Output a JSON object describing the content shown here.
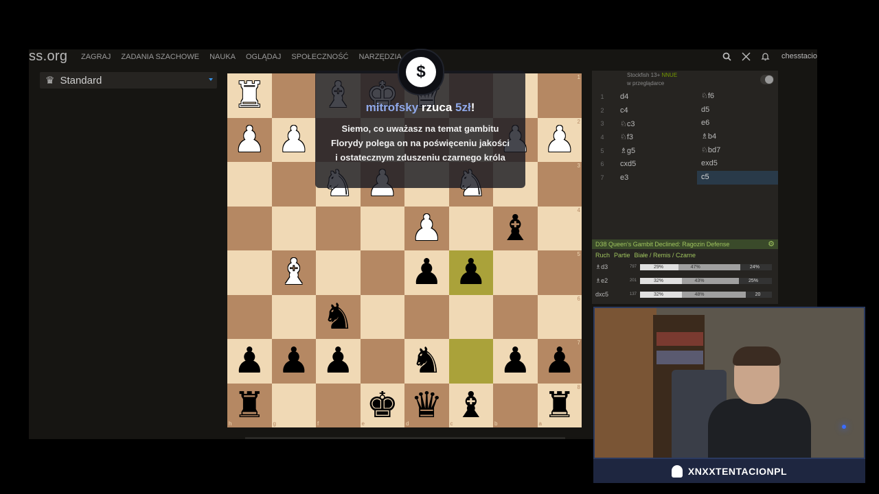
{
  "topbar": {
    "logo": "ss.org",
    "nav": [
      "ZAGRAJ",
      "ZADANIA SZACHOWE",
      "NAUKA",
      "OGLĄDAJ",
      "SPOŁECZNOŚĆ",
      "NARZĘDZIA"
    ],
    "username": "chesstacio"
  },
  "variant": {
    "label": "Standard",
    "icon": "crown-icon"
  },
  "board": {
    "rank_labels": [
      "1",
      "2",
      "3",
      "4",
      "5",
      "6",
      "7",
      "8"
    ],
    "file_labels": [
      "h",
      "g",
      "f",
      "e",
      "d",
      "c",
      "b",
      "a"
    ],
    "ranks": [
      [
        "♜",
        "",
        "♝",
        "♚",
        "♛",
        "",
        "",
        ""
      ],
      [
        "♟",
        "♟",
        "",
        "",
        "",
        "",
        "♟",
        "♟"
      ],
      [
        "",
        "",
        "♞",
        "♟",
        "",
        "♞",
        "",
        ""
      ],
      [
        "",
        "",
        "",
        "",
        "♟",
        "",
        "♝",
        ""
      ],
      [
        "",
        "♝",
        "",
        "",
        "♟",
        "♟",
        "",
        ""
      ],
      [
        "",
        "",
        "♞",
        "",
        "",
        "",
        "",
        ""
      ],
      [
        "♟",
        "♟",
        "♟",
        "",
        "♞",
        "",
        "♟",
        "♟"
      ],
      [
        "♜",
        "",
        "",
        "♚",
        "♛",
        "♝",
        "",
        "♜"
      ]
    ],
    "colors": [
      [
        "w",
        "",
        "w",
        "w",
        "w",
        "",
        "",
        ""
      ],
      [
        "w",
        "w",
        "",
        "",
        "",
        "",
        "w",
        "w"
      ],
      [
        "",
        "",
        "w",
        "w",
        "",
        "w",
        "",
        ""
      ],
      [
        "",
        "",
        "",
        "",
        "w",
        "",
        "b",
        ""
      ],
      [
        "",
        "w",
        "",
        "",
        "b",
        "b",
        "",
        ""
      ],
      [
        "",
        "",
        "b",
        "",
        "",
        "",
        "",
        ""
      ],
      [
        "b",
        "b",
        "b",
        "",
        "b",
        "",
        "b",
        "b"
      ],
      [
        "b",
        "",
        "",
        "b",
        "b",
        "b",
        "",
        "b"
      ]
    ],
    "highlights": [
      "4-5",
      "6-5"
    ]
  },
  "engine": {
    "name": "Stockfish 13+",
    "nnue": "NNUE",
    "sub": "w przeglądarce"
  },
  "moves": [
    {
      "n": "1",
      "w": "d4",
      "b": "♘f6"
    },
    {
      "n": "2",
      "w": "c4",
      "b": "d5"
    },
    {
      "n": "3",
      "w": "♘c3",
      "b": "e6"
    },
    {
      "n": "4",
      "w": "♘f3",
      "b": "♗b4"
    },
    {
      "n": "5",
      "w": "♗g5",
      "b": "♘bd7"
    },
    {
      "n": "6",
      "w": "cxd5",
      "b": "exd5"
    },
    {
      "n": "7",
      "w": "e3",
      "b": "c5"
    }
  ],
  "opening": {
    "name": "D38 Queen's Gambit Declined: Ragozin Defense"
  },
  "explorer": {
    "headers": [
      "Ruch",
      "Partie",
      "Białe / Remis / Czarne"
    ],
    "rows": [
      {
        "move": "♗d3",
        "games": "797",
        "white": 29,
        "draw": 47,
        "black": 24,
        "wl": "29%",
        "dl": "47%",
        "bl": "24%"
      },
      {
        "move": "♗e2",
        "games": "201",
        "white": 32,
        "draw": 43,
        "black": 25,
        "wl": "32%",
        "dl": "43%",
        "bl": "25%"
      },
      {
        "move": "dxc5",
        "games": "137",
        "white": 32,
        "draw": 48,
        "black": 20,
        "wl": "32%",
        "dl": "48%",
        "bl": "20"
      }
    ]
  },
  "alert": {
    "user": "mitrofsky",
    "mid": " rzuca ",
    "amount": "5zł",
    "end": "!",
    "message": "Siemo, co uważasz na temat gambitu Florydy polega on na poświęceniu jakości i ostatecznym zduszeniu czarnego króla",
    "icon_symbol": "$"
  },
  "camera": {
    "name": "XNXXTENTACIONPL"
  }
}
